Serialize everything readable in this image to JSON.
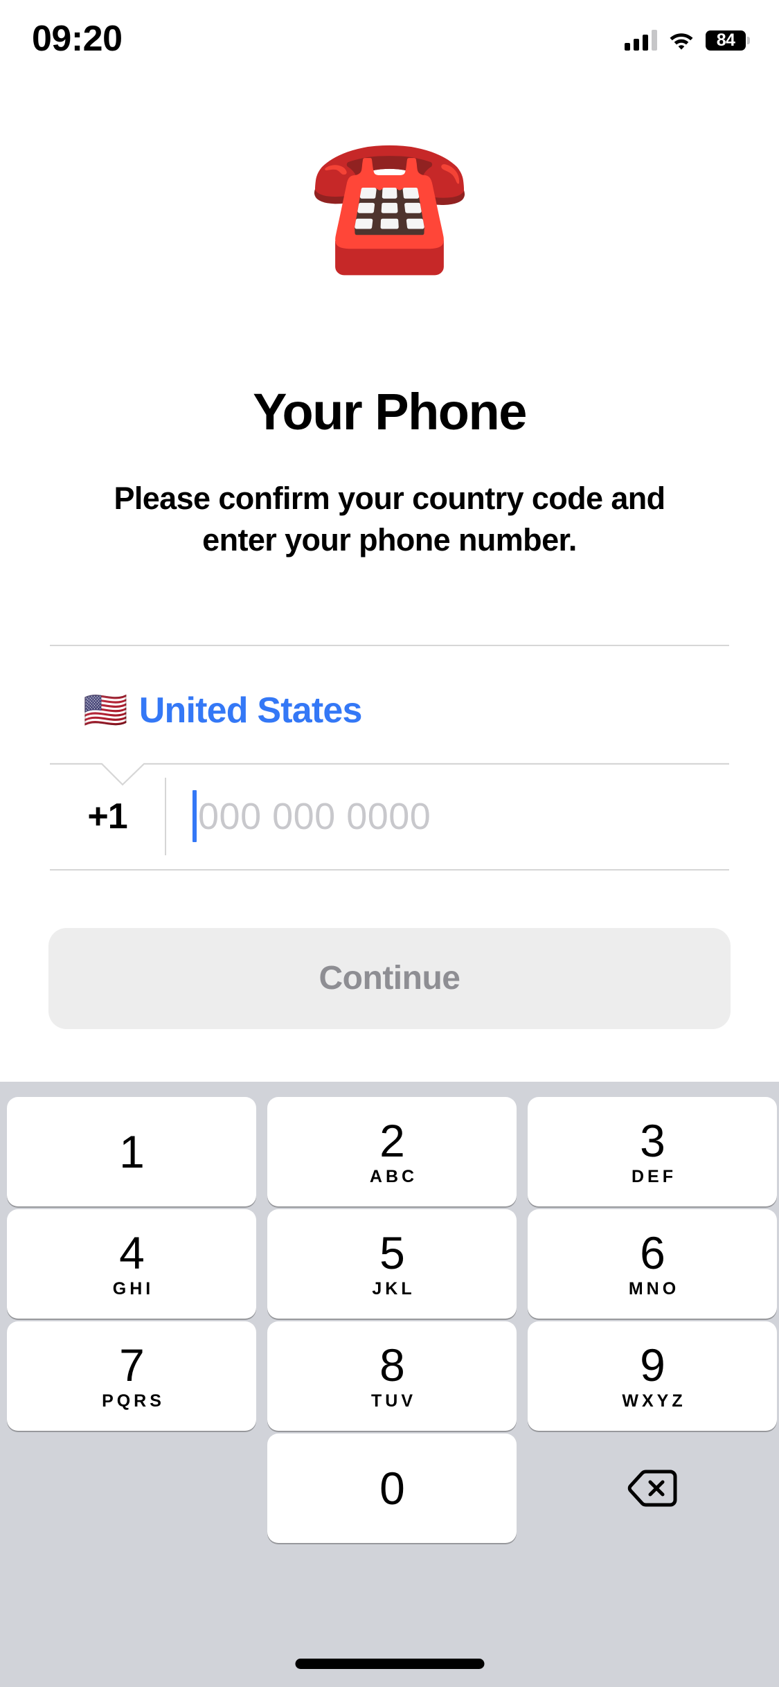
{
  "status_bar": {
    "time": "09:20",
    "battery_level": "84",
    "cellular_icon": "cellular-bars-icon",
    "wifi_icon": "wifi-icon",
    "battery_icon": "battery-icon"
  },
  "header": {
    "emoji": "☎️",
    "emoji_name": "telephone-emoji",
    "title": "Your Phone",
    "subtitle": "Please confirm your country code and enter your phone number."
  },
  "form": {
    "country": {
      "flag": "🇺🇸",
      "name": "United States",
      "name_color": "#3478f6"
    },
    "phone": {
      "country_code": "+1",
      "value": "",
      "placeholder": "000 000 0000",
      "placeholder_color": "#c8c8cc",
      "caret_color": "#3478f6"
    }
  },
  "continue_button": {
    "label": "Continue",
    "background": "#ededed",
    "text_color": "#8e8e93",
    "enabled": false
  },
  "keypad": {
    "background": "#d1d3d9",
    "key_background": "#ffffff",
    "backspace_icon": "backspace-icon",
    "keys": [
      {
        "digit": "1",
        "letters": ""
      },
      {
        "digit": "2",
        "letters": "ABC"
      },
      {
        "digit": "3",
        "letters": "DEF"
      },
      {
        "digit": "4",
        "letters": "GHI"
      },
      {
        "digit": "5",
        "letters": "JKL"
      },
      {
        "digit": "6",
        "letters": "MNO"
      },
      {
        "digit": "7",
        "letters": "PQRS"
      },
      {
        "digit": "8",
        "letters": "TUV"
      },
      {
        "digit": "9",
        "letters": "WXYZ"
      },
      {
        "digit": "0",
        "letters": ""
      }
    ]
  },
  "home_indicator": "home-indicator"
}
